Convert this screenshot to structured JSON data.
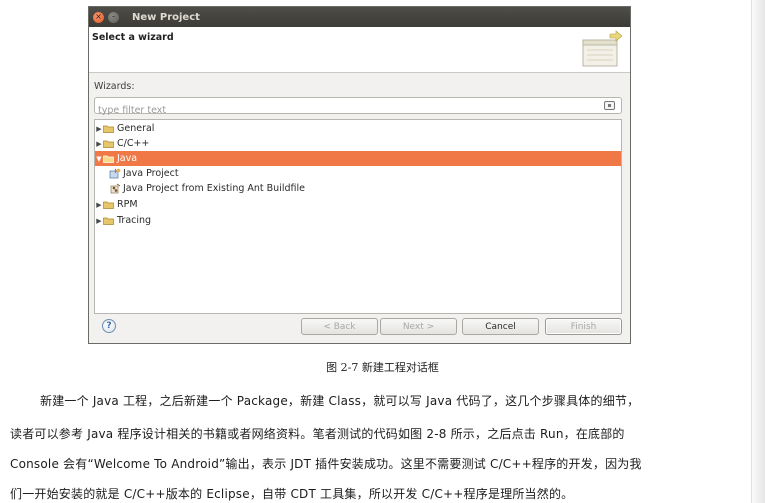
{
  "dialog": {
    "title": "New Project",
    "header_title": "Select a wizard",
    "wizards_label": "Wizards:",
    "filter_placeholder": "type filter text",
    "tree": [
      {
        "label": "General",
        "expanded": false,
        "level": 0,
        "icon": "folder-icon"
      },
      {
        "label": "C/C++",
        "expanded": false,
        "level": 0,
        "icon": "folder-icon"
      },
      {
        "label": "Java",
        "expanded": true,
        "level": 0,
        "icon": "folder-icon",
        "selected": true
      },
      {
        "label": "Java Project",
        "level": 1,
        "icon": "java-project-icon"
      },
      {
        "label": "Java Project from Existing Ant Buildfile",
        "level": 1,
        "icon": "ant-project-icon"
      },
      {
        "label": "RPM",
        "expanded": false,
        "level": 0,
        "icon": "folder-icon"
      },
      {
        "label": "Tracing",
        "expanded": false,
        "level": 0,
        "icon": "folder-icon"
      }
    ],
    "buttons": {
      "back": "< Back",
      "next": "Next >",
      "cancel": "Cancel",
      "finish": "Finish"
    },
    "colors": {
      "selection": "#f07746",
      "titlebar": "#3c3b37",
      "close_button": "#e2531f"
    }
  },
  "caption": "图 2-7 新建工程对话框",
  "paragraph": [
    "新建一个 Java 工程，之后新建一个 Package，新建 Class，就可以写 Java 代码了，这几个步骤具体的细节，",
    "读者可以参考 Java 程序设计相关的书籍或者网络资料。笔者测试的代码如图 2-8 所示，之后点击 Run，在底部的",
    "Console 会有“Welcome To Android”输出，表示 JDT 插件安装成功。这里不需要测试 C/C++程序的开发，因为我",
    "们一开始安装的就是 C/C++版本的 Eclipse，自带 CDT 工具集，所以开发 C/C++程序是理所当然的。"
  ]
}
